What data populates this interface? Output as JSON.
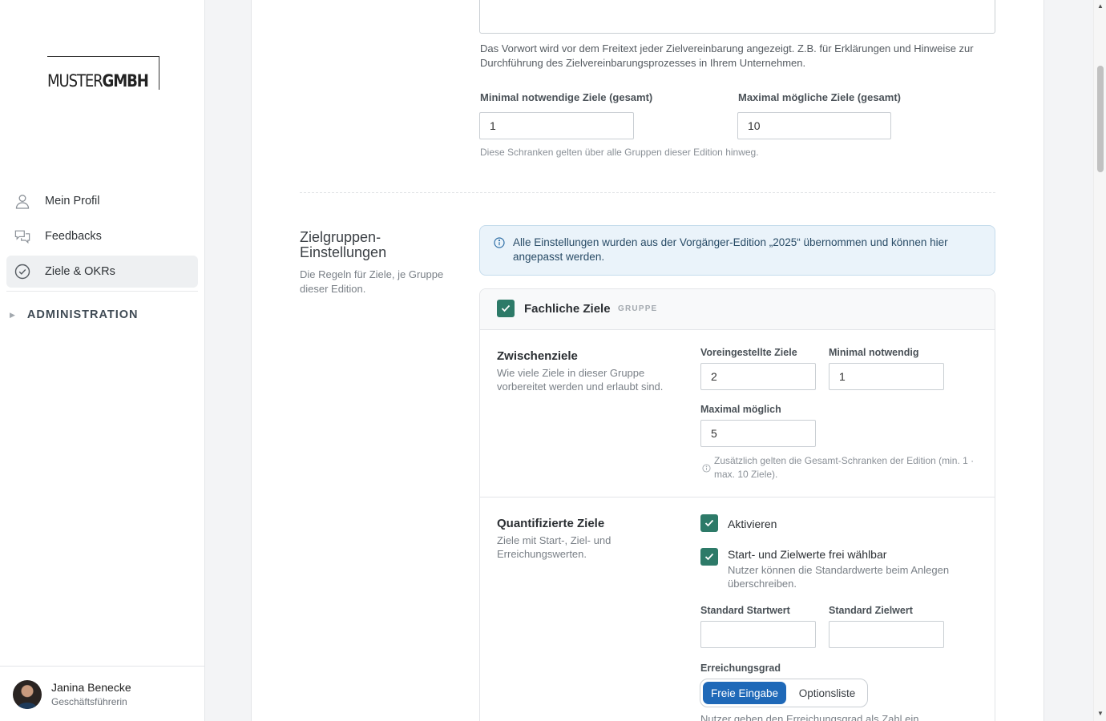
{
  "brand": {
    "logo_light": "MUSTER",
    "logo_bold": "GMBH"
  },
  "sidebar": {
    "items": [
      {
        "label": "Mein Profil",
        "icon": "person-icon"
      },
      {
        "label": "Feedbacks",
        "icon": "chat-bubbles-icon"
      },
      {
        "label": "Ziele & OKRs",
        "icon": "check-circle-icon",
        "active": true
      }
    ],
    "admin_label": "ADMINISTRATION"
  },
  "user": {
    "name": "Janina Benecke",
    "role": "Geschäftsführerin"
  },
  "foreword": {
    "help": "Das Vorwort wird vor dem Freitext jeder Zielvereinbarung angezeigt. Z.B. für Erklärungen und Hinweise zur Durchführung des Zielvereinbarungsprozesses in Ihrem Unternehmen.",
    "min_label": "Minimal notwendige Ziele (gesamt)",
    "min_value": "1",
    "max_label": "Maximal mögliche Ziele (gesamt)",
    "max_value": "10",
    "limits_help": "Diese Schranken gelten über alle Gruppen dieser Edition hinweg."
  },
  "groups_section": {
    "title": "Zielgruppen-Einstellungen",
    "desc": "Die Regeln für Ziele, je Gruppe dieser Edition.",
    "info": "Alle Einstellungen wurden aus der Vorgänger-Edition „2025“ übernommen und können hier angepasst werden.",
    "group": {
      "title": "Fachliche Ziele",
      "tag": "GRUPPE",
      "checked": true,
      "zwischenziele": {
        "title": "Zwischenziele",
        "desc": "Wie viele Ziele in dieser Gruppe vorbereitet werden und erlaubt sind.",
        "preset_label": "Voreingestellte Ziele",
        "preset_value": "2",
        "min_label": "Minimal notwendig",
        "min_value": "1",
        "max_label": "Maximal möglich",
        "max_value": "5",
        "note": "Zusätzlich gelten die Gesamt-Schranken der Edition (min. 1 · max. 10 Ziele)."
      },
      "quant": {
        "title": "Quantifizierte Ziele",
        "desc": "Ziele mit Start-, Ziel- und Erreichungswerten.",
        "activate_label": "Aktivieren",
        "activate_checked": true,
        "free_label": "Start- und Zielwerte frei wählbar",
        "free_checked": true,
        "free_help": "Nutzer können die Standardwerte beim Anlegen überschreiben.",
        "start_label": "Standard Startwert",
        "start_value": "",
        "target_label": "Standard Zielwert",
        "target_value": "",
        "degree_label": "Erreichungsgrad",
        "degree_options": [
          "Freie Eingabe",
          "Optionsliste"
        ],
        "degree_selected": "Freie Eingabe",
        "degree_help": "Nutzer geben den Erreichungsgrad als Zahl ein."
      }
    }
  },
  "colors": {
    "accent": "#1f69b8",
    "check": "#2d7a68",
    "info_bg": "#eaf3fa"
  }
}
